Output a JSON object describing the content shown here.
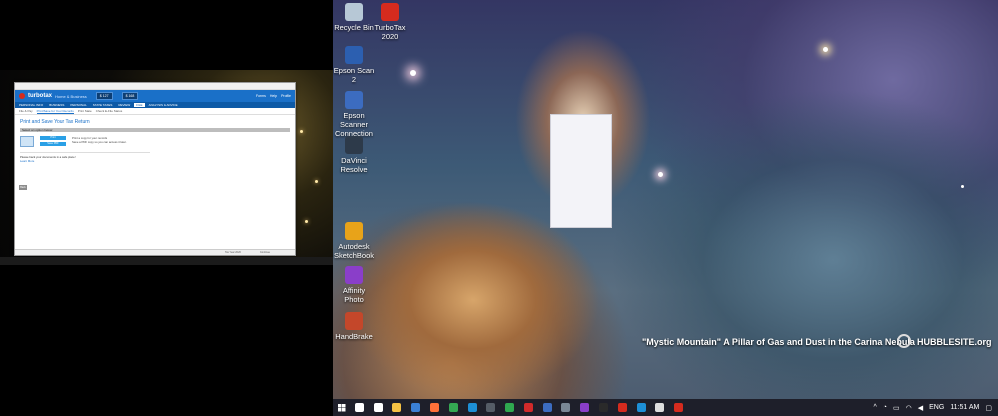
{
  "turbotax_window": {
    "brand": "turbotax",
    "brand_sub": "Home & Business",
    "refund_federal": "$ 127",
    "refund_state": "$ 168",
    "header_icons": [
      "Forms",
      "Help",
      "Profile"
    ],
    "nav_tabs": [
      "PERSONAL INFO",
      "BUSINESS",
      "PERSONAL",
      "STATE TAXES",
      "REVIEW",
      "FILE",
      "ANALYSIS & ADVICE"
    ],
    "nav_active": "FILE",
    "subtabs": [
      "File & Pay",
      "Print/Save for Your Records",
      "Print State",
      "Check E-File Status"
    ],
    "page_title": "Print and Save Your Tax Return",
    "section_title": "Select an option below:",
    "print_button": "Print",
    "save_button": "Save PDF",
    "print_desc": "Print a copy for your records",
    "save_desc": "Save a PDF copy so you can access it later.",
    "question": "Please back your documents in a safe place!",
    "learn_more": "Learn More",
    "back_button": "Back",
    "footer_left": "Tax Year 2020",
    "footer_right": "Continue"
  },
  "desktop": {
    "icons": [
      {
        "label": "Recycle Bin",
        "icon": "recycle-bin-icon",
        "color": "#b7c8d6"
      },
      {
        "label": "TurboTax 2020",
        "icon": "turbotax-icon",
        "color": "#d52b1e"
      },
      {
        "label": "Epson Scan 2",
        "icon": "epson-scan-icon",
        "color": "#2c5fb0"
      },
      {
        "label": "Epson Scanner Connection",
        "icon": "epson-connect-icon",
        "color": "#3c6cc0"
      },
      {
        "label": "DaVinci Resolve",
        "icon": "davinci-icon",
        "color": "#2d3a4a"
      },
      {
        "label": "Autodesk SketchBook",
        "icon": "sketchbook-icon",
        "color": "#e8a319"
      },
      {
        "label": "Affinity Photo",
        "icon": "affinity-photo-icon",
        "color": "#8a3ec9"
      },
      {
        "label": "HandBrake",
        "icon": "handbrake-icon",
        "color": "#c4472a"
      }
    ],
    "caption": "\"Mystic Mountain\" A Pillar of Gas and Dust in the Carina Nebula",
    "logo_text": "HUBBLESITE.org"
  },
  "taskbar": {
    "apps": [
      {
        "name": "search-icon",
        "color": "#ffffff"
      },
      {
        "name": "task-view-icon",
        "color": "#ffffff"
      },
      {
        "name": "file-explorer-icon",
        "color": "#f6c244"
      },
      {
        "name": "mail-icon",
        "color": "#3a7fd5"
      },
      {
        "name": "firefox-icon",
        "color": "#ff7139"
      },
      {
        "name": "chrome-icon",
        "color": "#34a853"
      },
      {
        "name": "edge-icon",
        "color": "#1d8fd6"
      },
      {
        "name": "camera-app-icon",
        "color": "#555c66"
      },
      {
        "name": "app-green-icon",
        "color": "#2fa84f"
      },
      {
        "name": "acrobat-icon",
        "color": "#d12a2a"
      },
      {
        "name": "app-blue-icon",
        "color": "#3c6cc0"
      },
      {
        "name": "davinci-taskbar-icon",
        "color": "#7a8795"
      },
      {
        "name": "app-purple-icon",
        "color": "#8a3ec9"
      },
      {
        "name": "app-dark-icon",
        "color": "#2a2a2a"
      },
      {
        "name": "app-red-icon",
        "color": "#d52b1e"
      },
      {
        "name": "app-blue2-icon",
        "color": "#1d8fd6"
      },
      {
        "name": "app-white-icon",
        "color": "#dddddd"
      },
      {
        "name": "turbotax-taskbar-icon",
        "color": "#d52b1e"
      }
    ],
    "tray": {
      "language": "ENG",
      "time": "11:51 AM"
    }
  }
}
